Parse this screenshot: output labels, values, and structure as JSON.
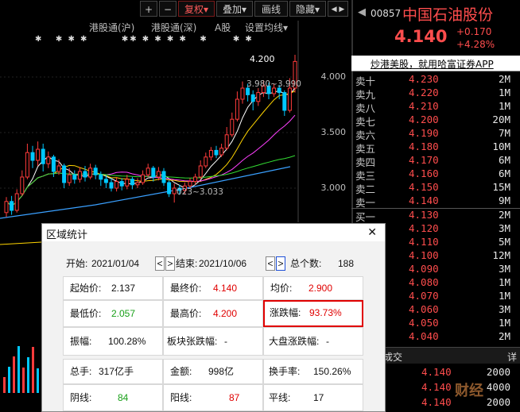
{
  "toolbar": {
    "plus": "+",
    "minus": "−",
    "fuquan": "复权",
    "diejia": "叠加",
    "huaxian": "画线",
    "yincang": "隐藏",
    "dropdown_arrow": "▾",
    "extra": "◀ ▶"
  },
  "menu": {
    "hk_sh": "港股通(沪)",
    "hk_sz": "港股通(深)",
    "a_share": "A股",
    "ma_settings": "设置均线"
  },
  "chart": {
    "y_labels": [
      "4.000",
      "3.500",
      "3.000"
    ],
    "annot_high": "4.200",
    "annot_mid": "3.980~3.990",
    "annot_low": "023~3.033",
    "candles": [
      {
        "o": 2.78,
        "c": 2.88,
        "h": 2.92,
        "l": 2.74
      },
      {
        "o": 2.88,
        "c": 2.8,
        "h": 2.93,
        "l": 2.76
      },
      {
        "o": 2.8,
        "c": 2.95,
        "h": 2.99,
        "l": 2.78
      },
      {
        "o": 2.95,
        "c": 3.1,
        "h": 3.16,
        "l": 2.93
      },
      {
        "o": 3.1,
        "c": 3.32,
        "h": 3.4,
        "l": 3.08
      },
      {
        "o": 3.32,
        "c": 3.25,
        "h": 3.38,
        "l": 3.18
      },
      {
        "o": 3.25,
        "c": 3.35,
        "h": 3.42,
        "l": 3.2
      },
      {
        "o": 3.35,
        "c": 3.22,
        "h": 3.4,
        "l": 3.15
      },
      {
        "o": 3.22,
        "c": 3.28,
        "h": 3.33,
        "l": 3.18
      },
      {
        "o": 3.28,
        "c": 3.15,
        "h": 3.3,
        "l": 3.1
      },
      {
        "o": 3.15,
        "c": 3.2,
        "h": 3.26,
        "l": 3.12
      },
      {
        "o": 3.2,
        "c": 3.05,
        "h": 3.22,
        "l": 3.0
      },
      {
        "o": 3.05,
        "c": 3.12,
        "h": 3.18,
        "l": 3.02
      },
      {
        "o": 3.12,
        "c": 3.08,
        "h": 3.16,
        "l": 3.04
      },
      {
        "o": 3.08,
        "c": 3.15,
        "h": 3.19,
        "l": 3.05
      },
      {
        "o": 3.15,
        "c": 3.1,
        "h": 3.2,
        "l": 3.06
      },
      {
        "o": 3.1,
        "c": 3.18,
        "h": 3.22,
        "l": 3.08
      },
      {
        "o": 3.18,
        "c": 3.12,
        "h": 3.21,
        "l": 3.08
      },
      {
        "o": 3.12,
        "c": 3.08,
        "h": 3.15,
        "l": 3.02
      },
      {
        "o": 3.08,
        "c": 3.05,
        "h": 3.12,
        "l": 3.0
      },
      {
        "o": 3.05,
        "c": 3.0,
        "h": 3.09,
        "l": 2.97
      },
      {
        "o": 3.0,
        "c": 3.06,
        "h": 3.1,
        "l": 2.97
      },
      {
        "o": 3.06,
        "c": 3.02,
        "h": 3.09,
        "l": 2.98
      },
      {
        "o": 3.02,
        "c": 3.08,
        "h": 3.12,
        "l": 2.99
      },
      {
        "o": 3.08,
        "c": 3.03,
        "h": 3.1,
        "l": 2.99
      },
      {
        "o": 3.03,
        "c": 3.05,
        "h": 3.09,
        "l": 3.0
      },
      {
        "o": 3.05,
        "c": 3.12,
        "h": 3.16,
        "l": 3.03
      },
      {
        "o": 3.12,
        "c": 3.18,
        "h": 3.22,
        "l": 3.1
      },
      {
        "o": 3.18,
        "c": 3.1,
        "h": 3.2,
        "l": 3.06
      },
      {
        "o": 3.1,
        "c": 3.15,
        "h": 3.19,
        "l": 3.07
      },
      {
        "o": 3.15,
        "c": 3.05,
        "h": 3.18,
        "l": 3.02
      },
      {
        "o": 3.05,
        "c": 2.95,
        "h": 3.07,
        "l": 2.92
      },
      {
        "o": 2.95,
        "c": 3.0,
        "h": 3.04,
        "l": 2.87
      },
      {
        "o": 3.0,
        "c": 2.98,
        "h": 3.03,
        "l": 2.94
      },
      {
        "o": 2.98,
        "c": 3.02,
        "h": 3.05,
        "l": 2.95
      },
      {
        "o": 3.02,
        "c": 3.06,
        "h": 3.09,
        "l": 3.0
      },
      {
        "o": 3.06,
        "c": 3.1,
        "h": 3.13,
        "l": 3.03
      },
      {
        "o": 3.1,
        "c": 3.2,
        "h": 3.25,
        "l": 3.08
      },
      {
        "o": 3.2,
        "c": 3.28,
        "h": 3.32,
        "l": 3.18
      },
      {
        "o": 3.28,
        "c": 3.34,
        "h": 3.37,
        "l": 3.25
      },
      {
        "o": 3.34,
        "c": 3.3,
        "h": 3.38,
        "l": 3.27
      },
      {
        "o": 3.3,
        "c": 3.36,
        "h": 3.4,
        "l": 3.28
      },
      {
        "o": 3.36,
        "c": 3.48,
        "h": 3.55,
        "l": 3.34
      },
      {
        "o": 3.48,
        "c": 3.62,
        "h": 3.68,
        "l": 3.46
      },
      {
        "o": 3.62,
        "c": 3.8,
        "h": 3.87,
        "l": 3.6
      },
      {
        "o": 3.8,
        "c": 3.9,
        "h": 3.96,
        "l": 3.76
      },
      {
        "o": 3.9,
        "c": 3.84,
        "h": 3.94,
        "l": 3.78
      },
      {
        "o": 3.84,
        "c": 3.78,
        "h": 3.88,
        "l": 3.7
      },
      {
        "o": 3.78,
        "c": 3.86,
        "h": 3.9,
        "l": 3.74
      },
      {
        "o": 3.86,
        "c": 3.92,
        "h": 3.97,
        "l": 3.82
      },
      {
        "o": 3.92,
        "c": 3.85,
        "h": 3.95,
        "l": 3.8
      },
      {
        "o": 3.85,
        "c": 3.9,
        "h": 3.94,
        "l": 3.82
      },
      {
        "o": 3.9,
        "c": 3.86,
        "h": 3.93,
        "l": 3.8
      },
      {
        "o": 3.86,
        "c": 3.7,
        "h": 3.88,
        "l": 3.65
      },
      {
        "o": 3.7,
        "c": 3.9,
        "h": 3.99,
        "l": 3.68
      },
      {
        "o": 3.9,
        "c": 4.14,
        "h": 4.2,
        "l": 3.86
      }
    ]
  },
  "stock": {
    "code": "00857",
    "name": "中国石油股份",
    "price": "4.140",
    "change": "+0.170",
    "change_pct": "+4.28%",
    "ad": "炒港美股，就用哈富证券APP"
  },
  "order_book": {
    "asks": [
      {
        "label": "卖十",
        "price": "4.230",
        "vol": "2M"
      },
      {
        "label": "卖九",
        "price": "4.220",
        "vol": "1M"
      },
      {
        "label": "卖八",
        "price": "4.210",
        "vol": "1M"
      },
      {
        "label": "卖七",
        "price": "4.200",
        "vol": "20M"
      },
      {
        "label": "卖六",
        "price": "4.190",
        "vol": "7M"
      },
      {
        "label": "卖五",
        "price": "4.180",
        "vol": "10M"
      },
      {
        "label": "卖四",
        "price": "4.170",
        "vol": "6M"
      },
      {
        "label": "卖三",
        "price": "4.160",
        "vol": "6M"
      },
      {
        "label": "卖二",
        "price": "4.150",
        "vol": "15M"
      },
      {
        "label": "卖一",
        "price": "4.140",
        "vol": "9M"
      }
    ],
    "bids": [
      {
        "label": "买一",
        "price": "4.130",
        "vol": "2M"
      },
      {
        "label": "",
        "price": "4.120",
        "vol": "3M"
      },
      {
        "label": "",
        "price": "4.110",
        "vol": "5M"
      },
      {
        "label": "",
        "price": "4.100",
        "vol": "12M"
      },
      {
        "label": "",
        "price": "4.090",
        "vol": "3M"
      },
      {
        "label": "",
        "price": "4.080",
        "vol": "1M"
      },
      {
        "label": "",
        "price": "4.070",
        "vol": "1M"
      },
      {
        "label": "",
        "price": "4.060",
        "vol": "3M"
      },
      {
        "label": "",
        "price": "4.050",
        "vol": "1M"
      },
      {
        "label": "",
        "price": "4.040",
        "vol": "2M"
      }
    ],
    "trades_title": "成交",
    "detail": "详",
    "trades": [
      {
        "price": "4.140",
        "vol": "2000"
      },
      {
        "price": "4.140",
        "vol": "4000"
      },
      {
        "price": "4.140",
        "vol": "2000"
      }
    ],
    "watermark": "财经"
  },
  "dialog": {
    "title": "区域统计",
    "close": "✕",
    "start_label": "开始:",
    "start_date": "2021/01/04",
    "end_label": "结束:",
    "end_date": "2021/10/06",
    "count_label": "总个数:",
    "count": "188",
    "prev": "<",
    "next": ">",
    "open_label": "起始价:",
    "open_value": "2.137",
    "close_label": "最终价:",
    "close_value": "4.140",
    "avg_label": "均价:",
    "avg_value": "2.900",
    "low_label": "最低价:",
    "low_value": "2.057",
    "high_label": "最高价:",
    "high_value": "4.200",
    "chg_label": "涨跌幅:",
    "chg_value": "93.73%",
    "amp_label": "振幅:",
    "amp_value": "100.28%",
    "sector_label": "板块张跌幅:",
    "sector_value": "-",
    "market_label": "大盘涨跌幅:",
    "market_value": "-",
    "vol_label": "总手:",
    "vol_value": "317亿手",
    "amt_label": "金额:",
    "amt_value": "998亿",
    "turn_label": "换手率:",
    "turn_value": "150.26%",
    "down_label": "阴线:",
    "down_value": "84",
    "up_label": "阳线:",
    "up_value": "87",
    "flat_label": "平线:",
    "flat_value": "17"
  },
  "colors": {
    "red": "#ff4d4d",
    "green": "#19b219",
    "cyan": "#00c8ff",
    "highlight": "#e00000"
  }
}
